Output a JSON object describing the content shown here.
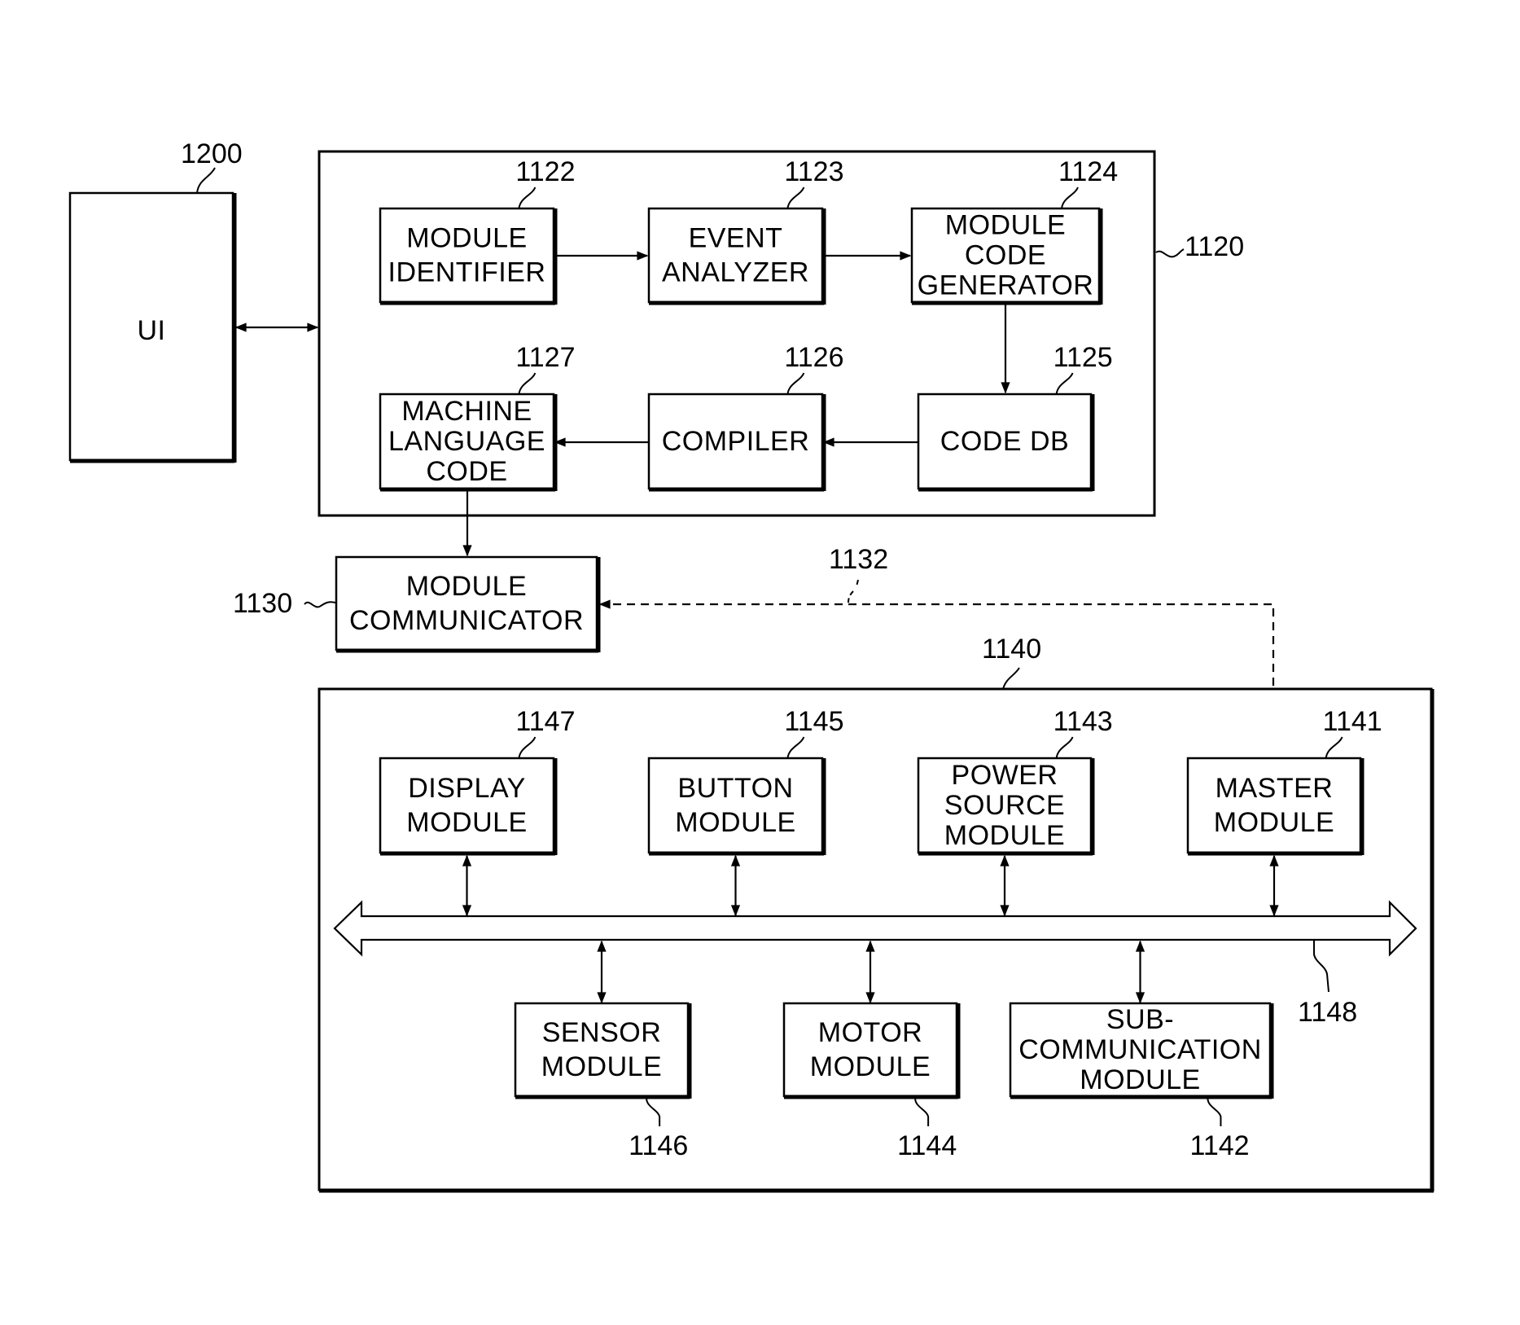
{
  "diagram": {
    "ui": {
      "label": "UI",
      "ref": "1200"
    },
    "controller": {
      "ref": "1120",
      "blocks": [
        {
          "id": "module-identifier",
          "ref": "1122",
          "lines": [
            "MODULE",
            "IDENTIFIER"
          ]
        },
        {
          "id": "event-analyzer",
          "ref": "1123",
          "lines": [
            "EVENT",
            "ANALYZER"
          ]
        },
        {
          "id": "module-code-generator",
          "ref": "1124",
          "lines": [
            "MODULE",
            "CODE",
            "GENERATOR"
          ]
        },
        {
          "id": "code-db",
          "ref": "1125",
          "lines": [
            "CODE DB"
          ]
        },
        {
          "id": "compiler",
          "ref": "1126",
          "lines": [
            "COMPILER"
          ]
        },
        {
          "id": "machine-language-code",
          "ref": "1127",
          "lines": [
            "MACHINE",
            "LANGUAGE",
            "CODE"
          ]
        }
      ]
    },
    "communicator": {
      "ref": "1130",
      "lines": [
        "MODULE",
        "COMMUNICATOR"
      ],
      "link_ref": "1132"
    },
    "module_group": {
      "ref": "1140",
      "bus_ref": "1148",
      "blocks": [
        {
          "id": "display-module",
          "ref": "1147",
          "lines": [
            "DISPLAY",
            "MODULE"
          ]
        },
        {
          "id": "button-module",
          "ref": "1145",
          "lines": [
            "BUTTON",
            "MODULE"
          ]
        },
        {
          "id": "power-source-module",
          "ref": "1143",
          "lines": [
            "POWER",
            "SOURCE",
            "MODULE"
          ]
        },
        {
          "id": "master-module",
          "ref": "1141",
          "lines": [
            "MASTER",
            "MODULE"
          ]
        },
        {
          "id": "sensor-module",
          "ref": "1146",
          "lines": [
            "SENSOR",
            "MODULE"
          ]
        },
        {
          "id": "motor-module",
          "ref": "1144",
          "lines": [
            "MOTOR",
            "MODULE"
          ]
        },
        {
          "id": "sub-communication-module",
          "ref": "1142",
          "lines": [
            "SUB-",
            "COMMUNICATION",
            "MODULE"
          ]
        }
      ]
    }
  }
}
